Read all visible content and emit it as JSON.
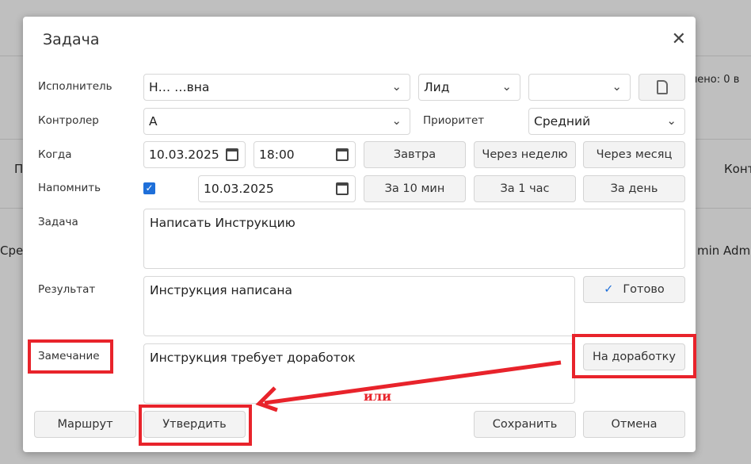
{
  "background": {
    "stat": "лено: 0",
    "stat_cut": "в",
    "col_p": "П",
    "col_kont": "Конт",
    "cell_sre": "Сре",
    "cell_admin": "min Adm"
  },
  "dialog": {
    "title": "Задача",
    "labels": {
      "executor": "Исполнитель",
      "controller": "Контролер",
      "priority": "Приоритет",
      "when": "Когда",
      "remind": "Напомнить",
      "task": "Задача",
      "result": "Результат",
      "remark": "Замечание"
    },
    "executor": "Н…  …вна",
    "role": "Лид",
    "extra": "",
    "controller": "А",
    "priority": "Средний",
    "date": "10.03.2025",
    "time": "18:00",
    "remind_checked": true,
    "remind_date": "10.03.2025",
    "quick_when": [
      "Завтра",
      "Через неделю",
      "Через месяц"
    ],
    "quick_remind": [
      "За 10 мин",
      "За 1 час",
      "За день"
    ],
    "task_text": "Написать Инструкцию",
    "result_text": "Инструкция написана",
    "remark_text": "Инструкция требует доработок",
    "done_label": "Готово",
    "rework_label": "На доработку",
    "route_label": "Маршрут",
    "approve_label": "Утвердить",
    "save_label": "Сохранить",
    "cancel_label": "Отмена"
  },
  "annotation": {
    "or_text": "или",
    "color": "#e8232b"
  }
}
